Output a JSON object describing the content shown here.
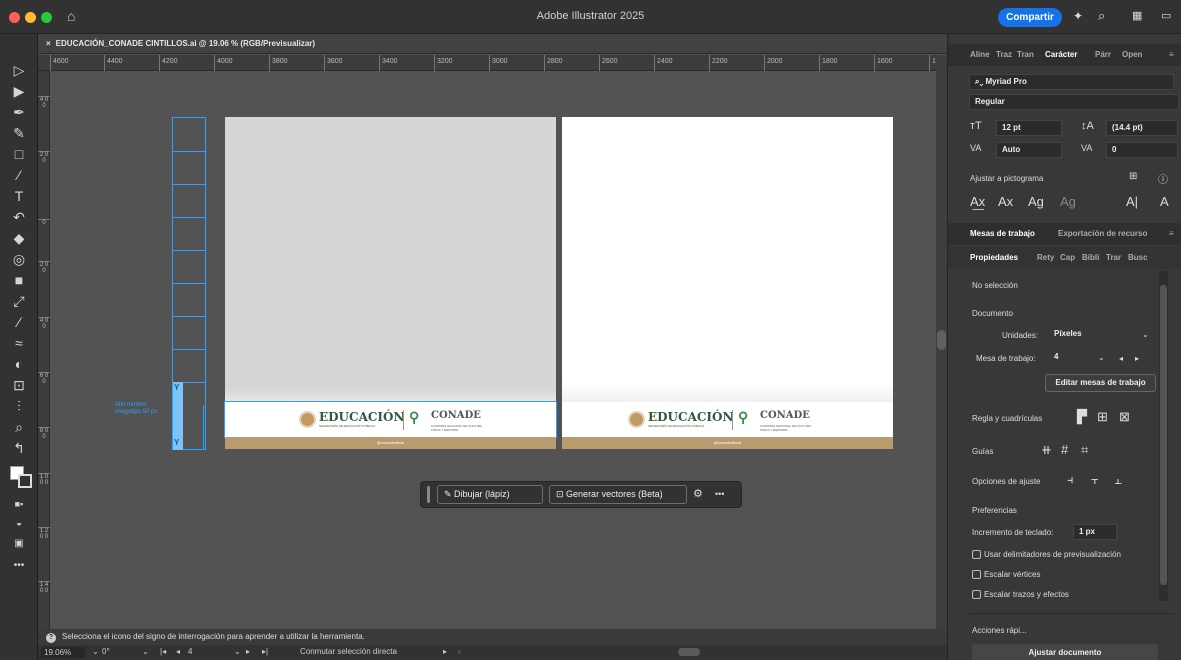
{
  "app": {
    "title": "Adobe Illustrator 2025",
    "share_label": "Compartir",
    "document_tab": "EDUCACIÓN_CONADE CINTILLOS.ai @ 19.06 % (RGB/Previsualizar)",
    "close_tab_label": "×"
  },
  "ruler": {
    "h_ticks": [
      "4600",
      "4400",
      "4200",
      "4000",
      "3800",
      "3600",
      "3400",
      "3200",
      "3000",
      "2800",
      "2600",
      "2400",
      "2200",
      "2000",
      "1800",
      "1600",
      "14"
    ],
    "v_ticks": [
      "4 0 0",
      "2 0 0",
      "0",
      "2 0 0",
      "4 0 0",
      "6 0 0",
      "8 0 0",
      "1 0 0 0",
      "1 2 0 0",
      "1 4 0 0"
    ]
  },
  "canvas": {
    "guide_note": "Alto mínimo imagotipo 50 px",
    "grid_marker": "Y",
    "logo_educacion": "EDUCACIÓN",
    "logo_educacion_sub": "SECRETARÍA DE EDUCACIÓN PÚBLICA",
    "logo_conade": "CONADE",
    "logo_conade_sub": "COMISIÓN NACIONAL DE CULTURA FÍSICA Y DEPORTE",
    "footer_handle": "@conadeoficial"
  },
  "contextual_bar": {
    "draw_label": "Dibujar (lápiz)",
    "vectors_label": "Generar vectores (Beta)",
    "more_label": "•••"
  },
  "status": {
    "hint": "Selecciona el icono del signo de interrogación para aprender a utilizar la herramienta.",
    "zoom": "19.06%",
    "rotation": "0°",
    "artboard": "4",
    "tool_status": "Conmutar selección directa"
  },
  "panel": {
    "top_tabs": [
      "Aline",
      "Traz",
      "Tran",
      "Carácter",
      "Párr",
      "Open"
    ],
    "font_family": "Myriad Pro",
    "font_style": "Regular",
    "font_size": "12 pt",
    "leading": "(14.4 pt)",
    "kerning": "Auto",
    "tracking": "0",
    "snap_label": "Ajustar a pictograma",
    "artboards_tab": "Mesas de trabajo",
    "export_tab": "Exportación de recurso",
    "prop_tabs": [
      "Propiedades",
      "Rety",
      "Cap",
      "Bibli",
      "Trar",
      "Busc"
    ],
    "no_selection": "No selección",
    "document_heading": "Documento",
    "units_label": "Unidades:",
    "units_value": "Píxeles",
    "artboard_label": "Mesa de trabajo:",
    "artboard_value": "4",
    "edit_artboards": "Editar mesas de trabajo",
    "rulers_grids": "Regla y cuadrículas",
    "guides": "Guías",
    "snap_options": "Opciones de ajuste",
    "preferences": "Preferencias",
    "keyboard_increment_label": "Incremento de teclado:",
    "keyboard_increment_value": "1 px",
    "preview_bounds": "Usar delimitadores de previsualización",
    "scale_corners": "Escalar vértices",
    "scale_strokes": "Escalar trazos y efectos",
    "quick_actions": "Acciones rápi...",
    "fit_document": "Ajustar documento"
  }
}
